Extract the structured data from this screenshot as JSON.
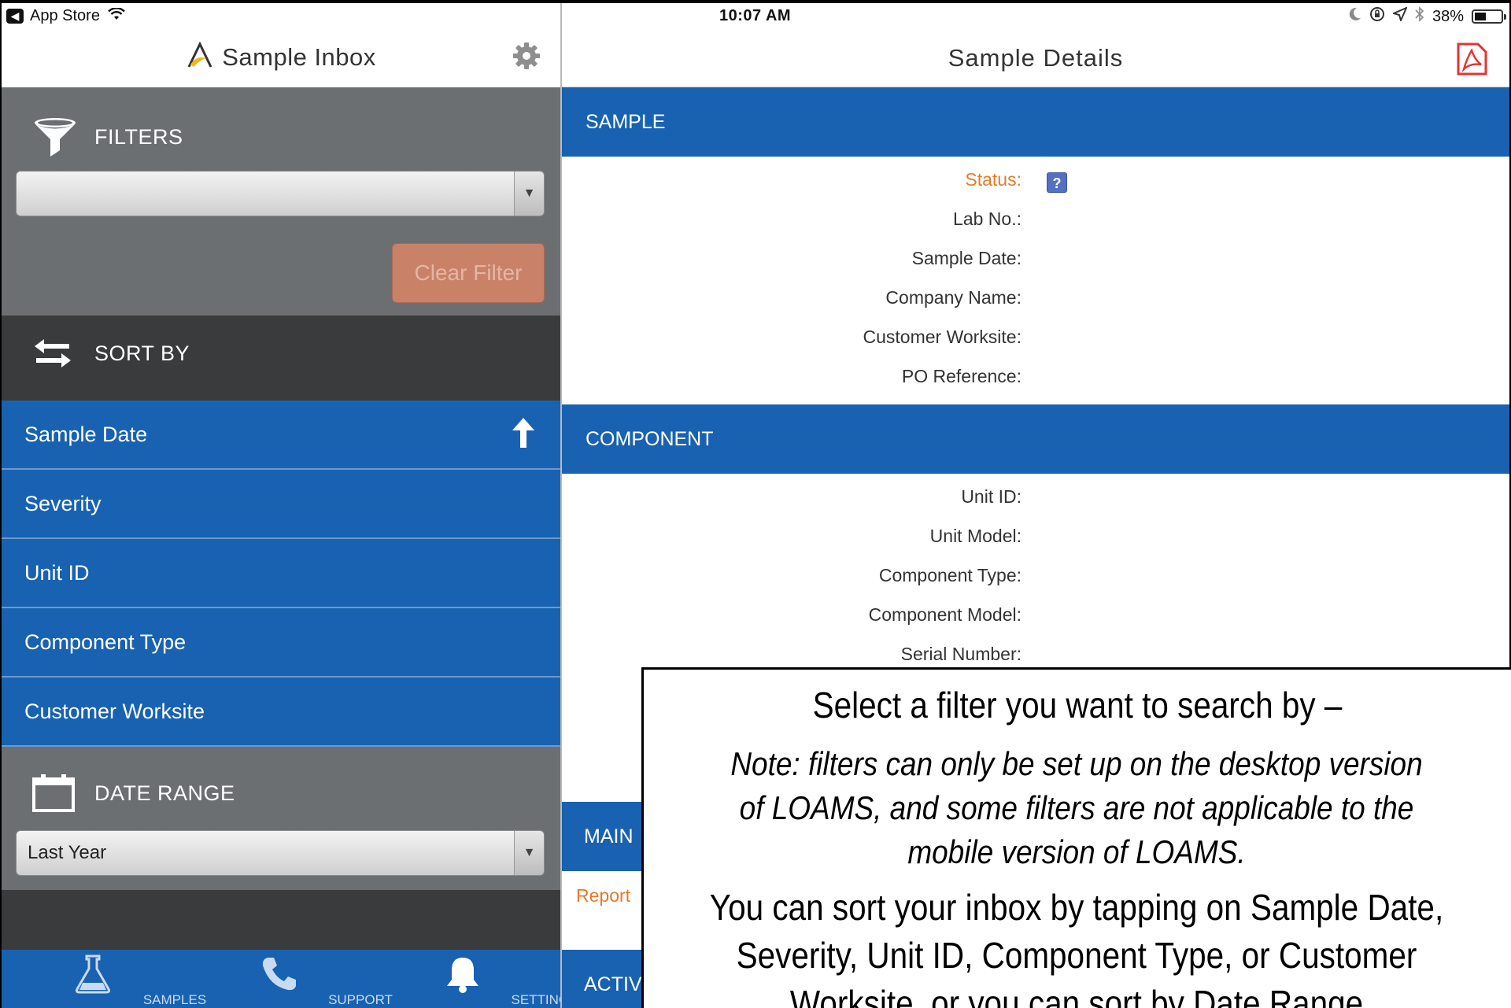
{
  "status_bar": {
    "back_app": "App Store",
    "time": "10:07 AM",
    "battery": "38%"
  },
  "left_nav": {
    "title": "Sample Inbox"
  },
  "filters": {
    "label": "FILTERS",
    "selected": "",
    "clear_button": "Clear Filter"
  },
  "sort": {
    "label": "SORT BY",
    "items": [
      {
        "label": "Sample Date",
        "active": true
      },
      {
        "label": "Severity"
      },
      {
        "label": "Unit ID"
      },
      {
        "label": "Component Type"
      },
      {
        "label": "Customer Worksite"
      }
    ]
  },
  "date_range": {
    "label": "DATE RANGE",
    "selected": "Last Year"
  },
  "tabs": [
    {
      "label": "SAMPLES",
      "icon": "flask-icon"
    },
    {
      "label": "SUPPORT",
      "icon": "phone-icon"
    },
    {
      "label": "SETTINGS",
      "icon": "bell-icon"
    }
  ],
  "details": {
    "title": "Sample Details",
    "sample_section": "SAMPLE",
    "sample_fields": [
      "Status:",
      "Lab No.:",
      "Sample Date:",
      "Company Name:",
      "Customer Worksite:",
      "PO Reference:"
    ],
    "status_badge": "?",
    "component_section": "COMPONENT",
    "component_fields": [
      "Unit ID:",
      "Unit Model:",
      "Component Type:",
      "Component Model:",
      "Serial Number:"
    ],
    "partial_section_1": "MAIN",
    "partial_report": "Report",
    "partial_section_2": "ACTIVI"
  },
  "callout": {
    "line1": "Select a filter you want to search by –",
    "line2": "Note: filters can only be set up on the desktop version of LOAMS, and some filters are not applicable to the mobile version of LOAMS.",
    "line3": "You can sort your inbox by tapping on Sample Date, Severity, Unit ID, Component Type, or Customer Worksite, or you can sort by Date Range"
  },
  "colors": {
    "primary_blue": "#1862b1",
    "panel_gray": "#6c6f71",
    "dark_gray": "#3a3b3c",
    "accent_orange": "#e67a2b",
    "clear_button": "#c98268"
  }
}
